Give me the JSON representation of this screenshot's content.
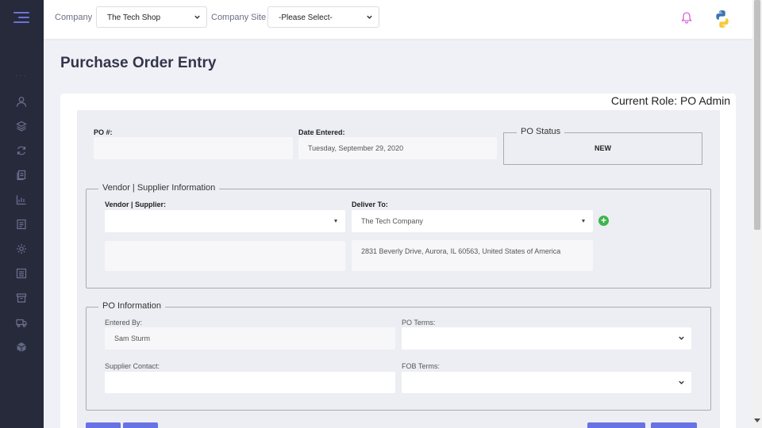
{
  "header": {
    "company_label": "Company",
    "company_value": "The Tech Shop",
    "site_label": "Company Site",
    "site_value": "-Please Select-"
  },
  "page": {
    "title": "Purchase Order Entry",
    "role": "Current Role: PO Admin"
  },
  "po": {
    "number_label": "PO #:",
    "number_value": "",
    "date_label": "Date Entered:",
    "date_value": "Tuesday, September 29, 2020",
    "status_legend": "PO Status",
    "status_value": "NEW"
  },
  "vendor": {
    "legend": "Vendor | Supplier Information",
    "supplier_label": "Vendor | Supplier:",
    "supplier_value": "",
    "supplier_address": "",
    "deliver_label": "Deliver To:",
    "deliver_value": "The Tech Company",
    "deliver_address": "2831 Beverly Drive, Aurora, IL 60563, United States of America"
  },
  "po_info": {
    "legend": "PO Information",
    "entered_by_label": "Entered By:",
    "entered_by_value": "Sam Sturm",
    "po_terms_label": "PO Terms:",
    "po_terms_value": "",
    "supplier_contact_label": "Supplier Contact:",
    "supplier_contact_value": "",
    "fob_terms_label": "FOB Terms:",
    "fob_terms_value": ""
  },
  "colors": {
    "sidebar": "#262a3b",
    "accent": "#6772e5",
    "success": "#3fb34f"
  },
  "icons": [
    "menu-icon",
    "user-icon",
    "layers-icon",
    "refresh-icon",
    "documents-icon",
    "chart-icon",
    "file-icon",
    "settings-icon",
    "list-icon",
    "archive-icon",
    "truck-icon",
    "package-icon",
    "bell-icon",
    "python-logo"
  ]
}
